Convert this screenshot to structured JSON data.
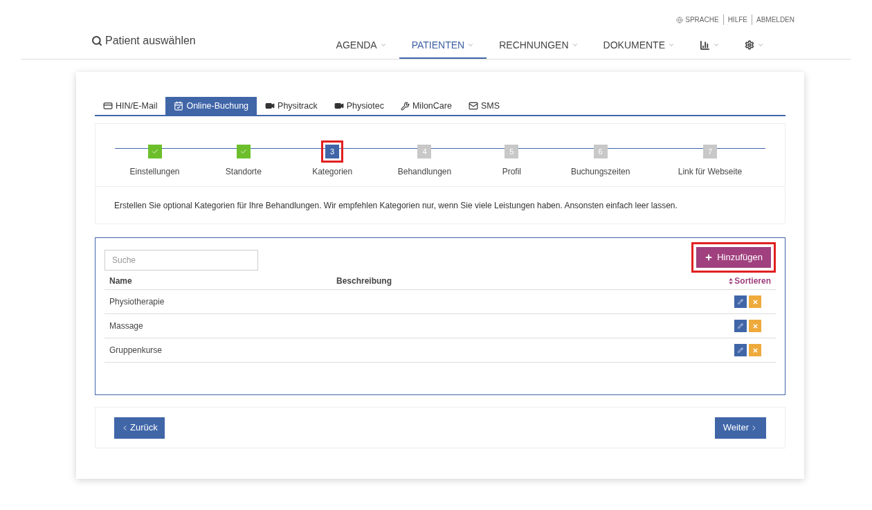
{
  "top_links": [
    {
      "kind": "globe",
      "label": "SPRACHE"
    },
    {
      "kind": "plain",
      "label": "HILFE"
    },
    {
      "kind": "plain",
      "label": "ABMELDEN"
    }
  ],
  "patient_search": {
    "label": "Patient auswählen"
  },
  "nav": [
    {
      "kind": "text",
      "label": "AGENDA",
      "selected": false
    },
    {
      "kind": "text",
      "label": "PATIENTEN",
      "selected": true
    },
    {
      "kind": "text",
      "label": "RECHNUNGEN",
      "selected": false
    },
    {
      "kind": "text",
      "label": "DOKUMENTE",
      "selected": false
    },
    {
      "kind": "chart",
      "selected": false
    },
    {
      "kind": "gear",
      "selected": false
    }
  ],
  "tabs": [
    {
      "kind": "card",
      "label": "HIN/E-Mail",
      "selected": false
    },
    {
      "kind": "calendar",
      "label": "Online-Buchung",
      "selected": true
    },
    {
      "kind": "video",
      "label": "Physitrack",
      "selected": false
    },
    {
      "kind": "video",
      "label": "Physiotec",
      "selected": false
    },
    {
      "kind": "wrench",
      "label": "MilonCare",
      "selected": false
    },
    {
      "kind": "mail",
      "label": "SMS",
      "selected": false
    }
  ],
  "steps": [
    {
      "kind": "done",
      "label": "Einstellungen",
      "highlighted": false
    },
    {
      "kind": "done",
      "label": "Standorte",
      "highlighted": false
    },
    {
      "kind": "current",
      "number": "3",
      "label": "Kategorien",
      "highlighted": true
    },
    {
      "kind": "todo",
      "number": "4",
      "label": "Behandlungen",
      "highlighted": false
    },
    {
      "kind": "todo",
      "number": "5",
      "label": "Profil",
      "highlighted": false
    },
    {
      "kind": "todo",
      "number": "6",
      "label": "Buchungszeiten",
      "highlighted": false
    },
    {
      "kind": "todo",
      "number": "7",
      "label": "Link für Webseite",
      "highlighted": false
    }
  ],
  "hint": "Erstellen Sie optional Kategorien für Ihre Behandlungen. Wir empfehlen Kategorien nur, wenn Sie viele Leistungen haben. Ansonsten einfach leer lassen.",
  "search": {
    "placeholder": "Suche"
  },
  "add_button": {
    "label": "Hinzufügen",
    "highlighted": true
  },
  "table": {
    "columns": [
      "Name",
      "Beschreibung"
    ],
    "sort_label": "Sortieren",
    "rows": [
      {
        "name": "Physiotherapie"
      },
      {
        "name": "Massage"
      },
      {
        "name": "Gruppenkurse"
      }
    ]
  },
  "footer": {
    "back": "Zurück",
    "next": "Weiter"
  }
}
